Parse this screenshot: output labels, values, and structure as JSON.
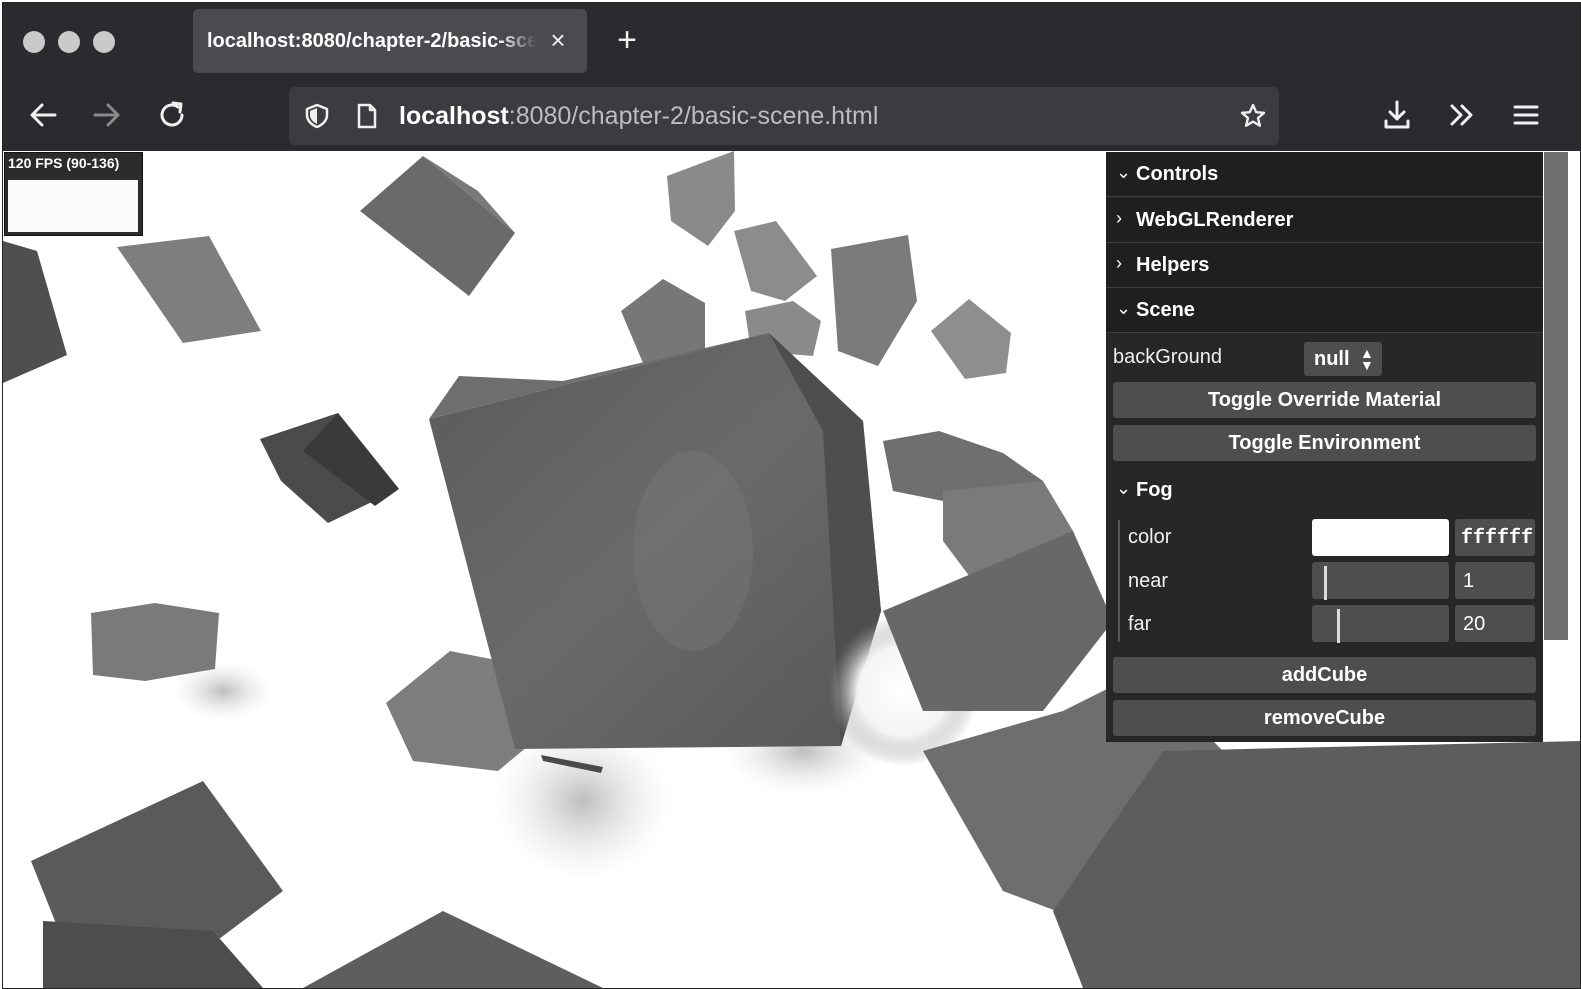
{
  "browser": {
    "tab": {
      "title": "localhost:8080/chapter-2/basic-scene.html",
      "close_label": "×"
    },
    "new_tab_label": "+",
    "url": {
      "host": "localhost",
      "rest": ":8080/chapter-2/basic-scene.html"
    }
  },
  "stats": {
    "fps_text": "120 FPS (90-136)"
  },
  "gui": {
    "sections": {
      "controls": "Controls",
      "webgl_renderer": "WebGLRenderer",
      "helpers": "Helpers",
      "scene": "Scene",
      "fog": "Fog"
    },
    "scene": {
      "background_label": "backGround",
      "background_value": "null",
      "toggle_override_label": "Toggle Override Material",
      "toggle_environment_label": "Toggle Environment"
    },
    "fog": {
      "color_label": "color",
      "color_value": "ffffff",
      "color_swatch": "#ffffff",
      "near_label": "near",
      "near_value": "1",
      "far_label": "far",
      "far_value": "20"
    },
    "actions": {
      "add_cube_label": "addCube",
      "remove_cube_label": "removeCube"
    }
  },
  "colors": {
    "chrome_bg": "#2b2b2f",
    "tab_active": "#4a4a4f",
    "urlbar_bg": "#3c3c40",
    "panel_bg": "#272727",
    "panel_control": "#4e4e4e"
  }
}
